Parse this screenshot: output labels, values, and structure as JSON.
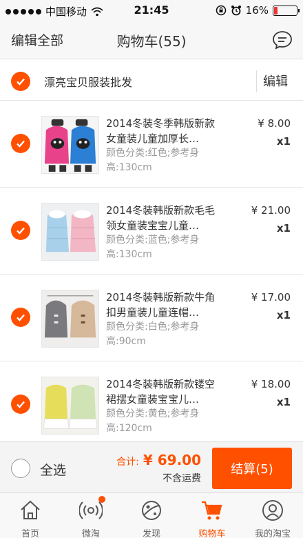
{
  "status_bar": {
    "carrier": "中国移动",
    "time": "21:45",
    "battery": "16%",
    "battery_level": 0.16
  },
  "nav": {
    "left_label": "编辑全部",
    "title": "购物车(55)",
    "right_icon": "message-icon"
  },
  "shop": {
    "name": "漂亮宝贝服装批发",
    "edit_label": "编辑",
    "checked": true
  },
  "items": [
    {
      "title": "2014冬装冬季韩版新款女童装儿童加厚长…",
      "spec": "颜色分类:红色;参考身高:130cm",
      "price": "¥ 8.00",
      "qty": "x1",
      "checked": true
    },
    {
      "title": "2014冬装韩版新款毛毛领女童装宝宝儿童…",
      "spec": "颜色分类:蓝色;参考身高:130cm",
      "price": "¥ 21.00",
      "qty": "x1",
      "checked": true
    },
    {
      "title": "2014冬装韩版新款牛角扣男童装儿童连帽…",
      "spec": "颜色分类:白色;参考身高:90cm",
      "price": "¥ 17.00",
      "qty": "x1",
      "checked": true
    },
    {
      "title": "2014冬装韩版新款镂空裙摆女童装宝宝儿…",
      "spec": "颜色分类:黄色;参考身高:120cm",
      "price": "¥ 18.00",
      "qty": "x1",
      "checked": true
    }
  ],
  "checkout": {
    "select_all_label": "全选",
    "total_label": "合计:",
    "total_amount": "¥ 69.00",
    "shipping_note": "不含运费",
    "checkout_button": "结算(5)"
  },
  "tabs": [
    {
      "label": "首页",
      "icon": "home-icon",
      "active": false
    },
    {
      "label": "微淘",
      "icon": "broadcast-icon",
      "active": false,
      "badge": true
    },
    {
      "label": "发现",
      "icon": "planet-icon",
      "active": false
    },
    {
      "label": "购物车",
      "icon": "cart-icon",
      "active": true
    },
    {
      "label": "我的淘宝",
      "icon": "profile-icon",
      "active": false
    }
  ],
  "colors": {
    "accent": "#ff5000",
    "text": "#333333",
    "muted": "#999999"
  }
}
